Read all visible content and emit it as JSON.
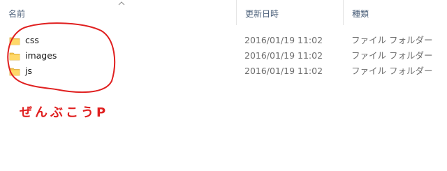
{
  "columns": {
    "name": "名前",
    "date": "更新日時",
    "type": "種類"
  },
  "sort_icon": "chevron-up-icon",
  "folder_icon": "folder-icon",
  "rows": [
    {
      "name": "css",
      "date": "2016/01/19 11:02",
      "type": "ファイル フォルダー"
    },
    {
      "name": "images",
      "date": "2016/01/19 11:02",
      "type": "ファイル フォルダー"
    },
    {
      "name": "js",
      "date": "2016/01/19 11:02",
      "type": "ファイル フォルダー"
    }
  ],
  "annotation": {
    "text": "ぜんぶこうP",
    "color": "#e02020"
  },
  "colors": {
    "folder": "#f4c64c",
    "header_text": "#4c607a",
    "meta_text": "#6d6d6d"
  }
}
